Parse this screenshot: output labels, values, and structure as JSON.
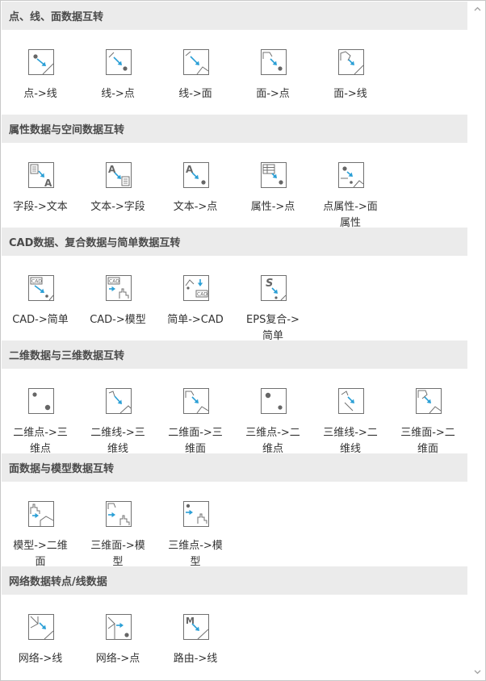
{
  "colors": {
    "header_bg": "#ebebeb",
    "accent": "#2a9fd6",
    "icon_stroke": "#707070"
  },
  "sections": [
    {
      "title": "点、线、面数据互转",
      "items": [
        {
          "label": "点->线",
          "icon": "point-to-line-icon"
        },
        {
          "label": "线->点",
          "icon": "line-to-point-icon"
        },
        {
          "label": "线->面",
          "icon": "line-to-polygon-icon"
        },
        {
          "label": "面->点",
          "icon": "polygon-to-point-icon"
        },
        {
          "label": "面->线",
          "icon": "polygon-to-line-icon"
        }
      ]
    },
    {
      "title": "属性数据与空间数据互转",
      "items": [
        {
          "label": "字段->文本",
          "icon": "field-to-text-icon"
        },
        {
          "label": "文本->字段",
          "icon": "text-to-field-icon"
        },
        {
          "label": "文本->点",
          "icon": "text-to-point-icon"
        },
        {
          "label": "属性->点",
          "icon": "attribute-to-point-icon"
        },
        {
          "label": "点属性->面属性",
          "icon": "point-attr-to-polygon-attr-icon"
        }
      ]
    },
    {
      "title": "CAD数据、复合数据与简单数据互转",
      "items": [
        {
          "label": "CAD->简单",
          "icon": "cad-to-simple-icon"
        },
        {
          "label": "CAD->模型",
          "icon": "cad-to-model-icon"
        },
        {
          "label": "简单->CAD",
          "icon": "simple-to-cad-icon"
        },
        {
          "label": "EPS复合->简单",
          "icon": "eps-compound-to-simple-icon"
        }
      ]
    },
    {
      "title": "二维数据与三维数据互转",
      "items": [
        {
          "label": "二维点->三维点",
          "icon": "2d-point-to-3d-point-icon"
        },
        {
          "label": "二维线->三维线",
          "icon": "2d-line-to-3d-line-icon"
        },
        {
          "label": "二维面->三维面",
          "icon": "2d-polygon-to-3d-polygon-icon"
        },
        {
          "label": "三维点->二维点",
          "icon": "3d-point-to-2d-point-icon"
        },
        {
          "label": "三维线->二维线",
          "icon": "3d-line-to-2d-line-icon"
        },
        {
          "label": "三维面->二维面",
          "icon": "3d-polygon-to-2d-polygon-icon"
        }
      ]
    },
    {
      "title": "面数据与模型数据互转",
      "items": [
        {
          "label": "模型->二维面",
          "icon": "model-to-2d-polygon-icon"
        },
        {
          "label": "三维面->模型",
          "icon": "3d-polygon-to-model-icon"
        },
        {
          "label": "三维点->模型",
          "icon": "3d-point-to-model-icon"
        }
      ]
    },
    {
      "title": "网络数据转点/线数据",
      "items": [
        {
          "label": "网络->线",
          "icon": "network-to-line-icon"
        },
        {
          "label": "网络->点",
          "icon": "network-to-point-icon"
        },
        {
          "label": "路由->线",
          "icon": "route-to-line-icon"
        }
      ]
    }
  ]
}
